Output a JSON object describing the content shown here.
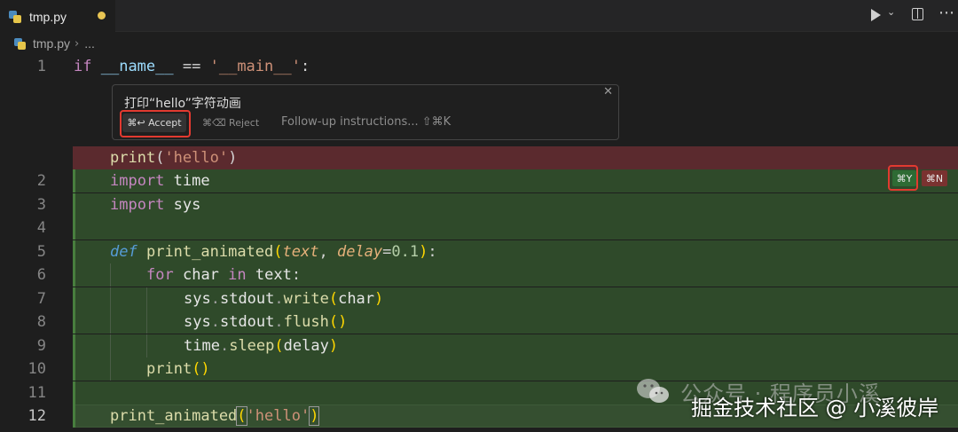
{
  "tab": {
    "label": "tmp.py"
  },
  "breadcrumb": {
    "file": "tmp.py",
    "sep": "›",
    "more": "..."
  },
  "toolbar": {
    "run_chevron": "⌄",
    "more": "⋯"
  },
  "chat": {
    "prompt": "打印“hello”字符动画",
    "accept_label": "⌘↩ Accept",
    "reject_label": "⌘⌫ Reject",
    "followup_placeholder": "Follow-up instructions... ⇧⌘K",
    "close": "✕"
  },
  "diff_badges": {
    "accept": "⌘Y",
    "reject": "⌘N"
  },
  "line_numbers": [
    "1",
    "2",
    "3",
    "4",
    "5",
    "6",
    "7",
    "8",
    "9",
    "10",
    "11",
    "12"
  ],
  "code": {
    "l1": [
      "if",
      "__name__",
      "==",
      "'__main__'",
      ":"
    ],
    "removed": [
      "print",
      "(",
      "'hello'",
      ")"
    ],
    "l2": [
      "import",
      "time"
    ],
    "l3": [
      "import",
      "sys"
    ],
    "l5": [
      "def",
      "print_animated",
      "(",
      "text",
      ",",
      "delay",
      "=",
      "0.1",
      ")",
      ":"
    ],
    "l6": [
      "for",
      "char",
      "in",
      "text",
      ":"
    ],
    "l7": [
      "sys",
      ".",
      "stdout",
      ".",
      "write",
      "(",
      "char",
      ")"
    ],
    "l8": [
      "sys",
      ".",
      "stdout",
      ".",
      "flush",
      "()"
    ],
    "l9": [
      "time",
      ".",
      "sleep",
      "(",
      "delay",
      ")"
    ],
    "l10": [
      "print",
      "()"
    ],
    "l12": [
      "print_animated",
      "(",
      "'hello'",
      ")"
    ]
  },
  "watermark": {
    "line1": "公众号 · 程序员小溪",
    "line2": "掘金技术社区 @ 小溪彼岸"
  },
  "colors": {
    "added_bg": "#2f4a2a",
    "removed_bg": "#5b2a2e",
    "highlight": "#e23a30"
  }
}
